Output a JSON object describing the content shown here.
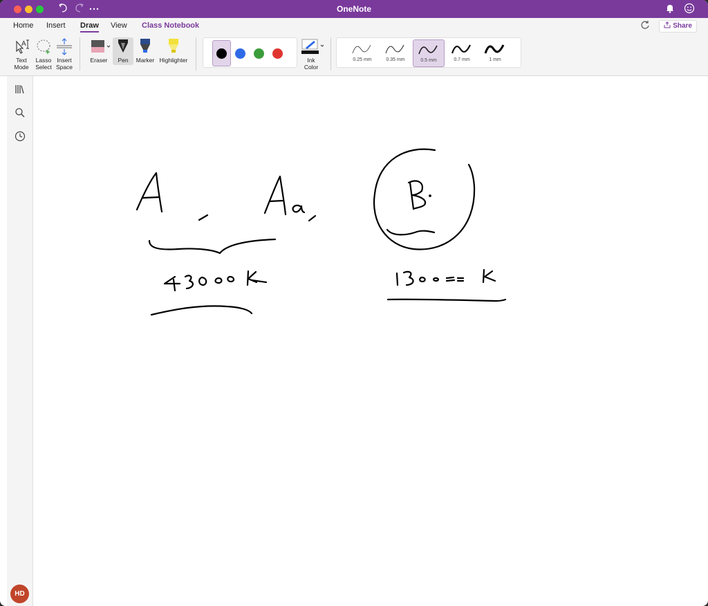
{
  "window": {
    "title": "OneNote"
  },
  "titlebar": {
    "undo_icon": "undo-icon",
    "redo_icon": "redo-icon",
    "more_icon": "more-icon",
    "bell_icon": "bell-icon",
    "smiley_icon": "smiley-icon"
  },
  "tabs": [
    {
      "label": "Home"
    },
    {
      "label": "Insert"
    },
    {
      "label": "Draw"
    },
    {
      "label": "View"
    },
    {
      "label": "Class Notebook"
    }
  ],
  "active_tab": "Draw",
  "share_label": "Share",
  "ribbon": {
    "text_mode": {
      "line1": "Text",
      "line2": "Mode"
    },
    "lasso_select": {
      "line1": "Lasso",
      "line2": "Select"
    },
    "insert_space": {
      "line1": "Insert",
      "line2": "Space"
    },
    "eraser": "Eraser",
    "pen": "Pen",
    "marker": "Marker",
    "highlighter": "Highlighter",
    "ink_color": {
      "line1": "Ink",
      "line2": "Color"
    },
    "colors": [
      "#000000",
      "#2f6ae6",
      "#3a9d3a",
      "#e0352f"
    ],
    "selected_color": "#000000",
    "thicknesses": [
      "0.25 mm",
      "0.35 mm",
      "0.5 mm",
      "0.7 mm",
      "1 mm"
    ],
    "selected_thickness": "0.5 mm"
  },
  "sidebar": {
    "notebooks_icon": "notebooks-icon",
    "search_icon": "search-icon",
    "recent_icon": "clock-icon",
    "user_initials": "HD"
  },
  "accent_color": "#7a3a9c"
}
